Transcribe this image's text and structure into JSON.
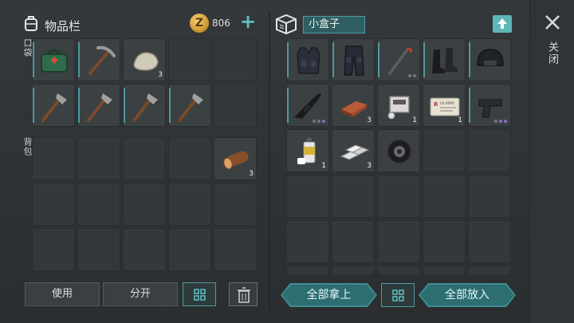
{
  "inventory": {
    "title": "物品栏",
    "coins": "806",
    "add_icon": "plus-icon",
    "pocket_label": "口袋",
    "backpack_label": "背包",
    "pocket_slots": [
      {
        "item": "green-medkit-bag",
        "qty": ""
      },
      {
        "item": "pickaxe",
        "qty": ""
      },
      {
        "item": "stone",
        "qty": "3"
      },
      {
        "item": "",
        "qty": ""
      },
      {
        "item": "",
        "qty": ""
      },
      {
        "item": "hatchet",
        "qty": ""
      },
      {
        "item": "hatchet",
        "qty": ""
      },
      {
        "item": "hatchet",
        "qty": ""
      },
      {
        "item": "hatchet",
        "qty": ""
      },
      {
        "item": "",
        "qty": ""
      }
    ],
    "backpack_slots": [
      {
        "item": "",
        "qty": ""
      },
      {
        "item": "",
        "qty": ""
      },
      {
        "item": "",
        "qty": ""
      },
      {
        "item": "",
        "qty": ""
      },
      {
        "item": "wood-log",
        "qty": "3"
      }
    ],
    "buttons": {
      "use": "使用",
      "split": "分开"
    }
  },
  "container": {
    "name": "小盒子",
    "close_label": "关闭",
    "slots": [
      {
        "item": "tactical-vest",
        "qty": ""
      },
      {
        "item": "tactical-pants",
        "qty": ""
      },
      {
        "item": "crowbar",
        "qty": ""
      },
      {
        "item": "combat-boots",
        "qty": ""
      },
      {
        "item": "combat-helmet",
        "qty": ""
      },
      {
        "item": "assault-rifle",
        "qty": ""
      },
      {
        "item": "copper-ingot",
        "qty": "3"
      },
      {
        "item": "engine-part",
        "qty": "1"
      },
      {
        "item": "army-id-card",
        "qty": "1"
      },
      {
        "item": "pistol",
        "qty": ""
      },
      {
        "item": "spray-can",
        "qty": "1"
      },
      {
        "item": "metal-bars",
        "qty": "3"
      },
      {
        "item": "tire-wheel",
        "qty": ""
      }
    ],
    "id_card_text": "US ARMY",
    "buttons": {
      "take_all": "全部拿上",
      "put_all": "全部放入"
    }
  },
  "colors": {
    "accent": "#4f9aa0",
    "button_teal": "#2d6e71",
    "coin": "#d9a63a"
  }
}
